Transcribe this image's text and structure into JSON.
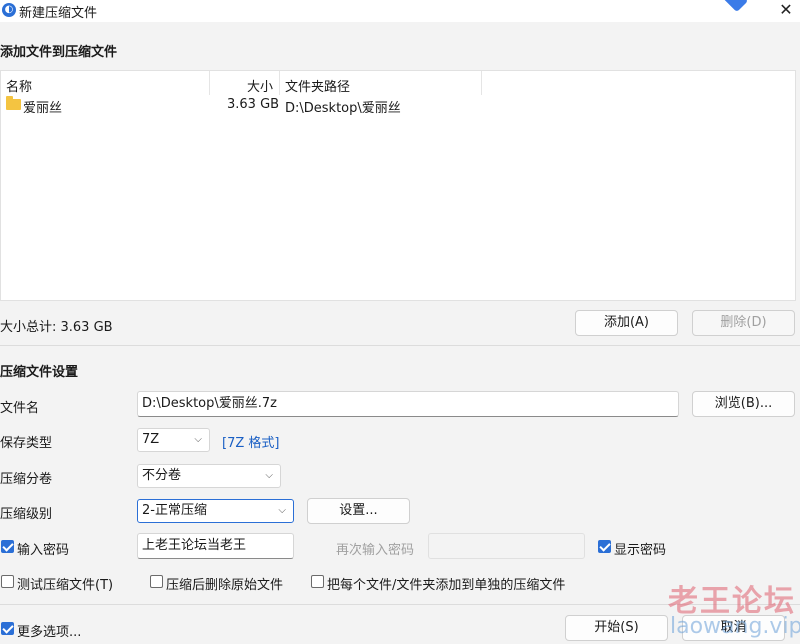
{
  "window": {
    "title": "新建压缩文件",
    "close_glyph": "✕"
  },
  "add_section": {
    "title": "添加文件到压缩文件",
    "columns": [
      "名称",
      "大小",
      "文件夹路径"
    ],
    "files": [
      {
        "name": "爱丽丝",
        "size": "3.63 GB",
        "path": "D:\\Desktop\\爱丽丝"
      }
    ],
    "total_label": "大小总计: 3.63 GB",
    "add_button": "添加(A)",
    "delete_button": "删除(D)"
  },
  "settings": {
    "title": "压缩文件设置",
    "filename_label": "文件名",
    "filename_value": "D:\\Desktop\\爱丽丝.7z",
    "browse_button": "浏览(B)...",
    "type_label": "保存类型",
    "type_value": "7Z",
    "type_link": "[7Z 格式]",
    "split_label": "压缩分卷",
    "split_value": "不分卷",
    "level_label": "压缩级别",
    "level_value": "2-正常压缩",
    "level_settings_button": "设置...",
    "password_checkbox": "输入密码",
    "password_value": "上老王论坛当老王",
    "reenter_label": "再次输入密码",
    "reenter_value": "",
    "show_password": "显示密码"
  },
  "options": {
    "test": "测试压缩文件(T)",
    "delete_source": "压缩后删除原始文件",
    "each_separate": "把每个文件/文件夹添加到单独的压缩文件"
  },
  "footer": {
    "more_options": "更多选项...",
    "start_button": "开始(S)",
    "cancel_button": "取消"
  },
  "watermark": {
    "cn": "老王论坛",
    "en": "laowang.vip"
  },
  "icons": [
    "app-icon",
    "folder-icon",
    "chevron-down-icon",
    "checkbox-icon"
  ],
  "colors": {
    "accent": "#2b6fd6",
    "link": "#1a5fc4",
    "folder": "#f4c441"
  }
}
